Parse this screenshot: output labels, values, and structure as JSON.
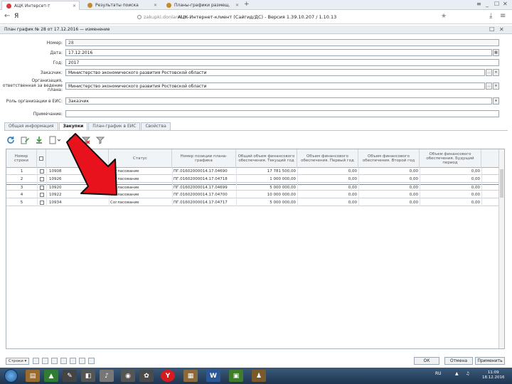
{
  "browser": {
    "tabs": [
      {
        "label": "АЦК Интерсет-т"
      },
      {
        "label": "Результаты поиска"
      },
      {
        "label": "Планы-графики размещ."
      }
    ],
    "new_tab": "+",
    "back": "←",
    "yandex": "Я",
    "domain": "zakupki.donland.ru",
    "page_title": "АЦК-Интернет-клиент (Сайгид/ДС) - Версия 1.39.10.207 / 1.10.13",
    "window_controls": [
      "≡",
      "_",
      "☐",
      "✕"
    ]
  },
  "window": {
    "title": "План график № 28 от 17.12.2016 — изменение",
    "menu_icon": "□",
    "close": "✕"
  },
  "form": {
    "number_label": "Номер:",
    "number_value": "28",
    "date_label": "Дата:",
    "date_value": "17.12.2016",
    "year_label": "Год:",
    "year_value": "2017",
    "customer_label": "Заказчик:",
    "customer_value": "Министерство экономического развития Ростовской области",
    "responsible_label": "Организация, ответственная за ведение плана:",
    "responsible_value": "Министерство экономического развития Ростовской области",
    "role_label": "Роль организации в ЕИС:",
    "role_value": "Заказчик",
    "note_label": "Примечание:",
    "note_value": "",
    "ellipsis": "...",
    "dropdown": "▾"
  },
  "tabs": [
    {
      "label": "Общая информация"
    },
    {
      "label": "Закупки"
    },
    {
      "label": "План-график в ЕИС"
    },
    {
      "label": "Свойства"
    }
  ],
  "toolbar": {
    "icons": [
      "refresh-icon",
      "edit-icon",
      "import-icon",
      "document-icon",
      "settings-icon",
      "clear-filter-icon",
      "filter-icon"
    ]
  },
  "grid": {
    "columns": [
      "Номер строки",
      "",
      "",
      "Статус",
      "Номер позиции плана-графика",
      "Общий объем финансового обеспечения. Текущий год",
      "Объем финансового обеспечения. Первый год",
      "Объем финансового обеспечения. Второй год",
      "Объем финансового обеспечения. Будущий период"
    ],
    "rows": [
      {
        "line": "1",
        "id": "10908",
        "status": "Согласование",
        "position": "ПГ.01602000014.17.04690",
        "total": "17 781 500,00",
        "y1": "0,00",
        "y2": "0,00",
        "future": "0,00"
      },
      {
        "line": "2",
        "id": "10926",
        "status": "Согласование",
        "position": "ПГ.01602000014.17.04718",
        "total": "1 000 000,00",
        "y1": "0,00",
        "y2": "0,00",
        "future": "0,00"
      },
      {
        "line": "3",
        "id": "10920",
        "status": "Согласование",
        "position": "ПГ.01602000014.17.04699",
        "total": "5 000 000,00",
        "y1": "0,00",
        "y2": "0,00",
        "future": "0,00"
      },
      {
        "line": "4",
        "id": "10922",
        "status": "Согласование",
        "position": "ПГ.01602000014.17.04700",
        "total": "10 000 000,00",
        "y1": "0,00",
        "y2": "0,00",
        "future": "0,00"
      },
      {
        "line": "5",
        "id": "10934",
        "status": "Согласование",
        "position": "ПГ.01602000014.17.04717",
        "total": "5 000 000,00",
        "y1": "0,00",
        "y2": "0,00",
        "future": "0,00"
      }
    ]
  },
  "footer": {
    "rows_select": "Строки ▾",
    "ok": "ОК",
    "cancel": "Отмена",
    "apply": "Применить"
  },
  "taskbar": {
    "apps": [
      "W",
      "Y"
    ],
    "lang": "RU",
    "time": "11:09",
    "date": "18.12.2016"
  },
  "colors": {
    "arrow": "#e8121c",
    "arrow_outline": "#111111",
    "header_bg": "#f1f4f7",
    "taskbar": "#2b4766"
  }
}
